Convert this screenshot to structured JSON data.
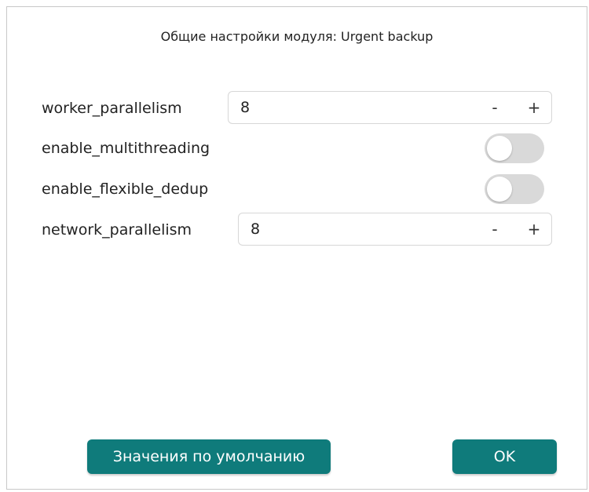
{
  "dialog": {
    "title": "Общие настройки модуля: Urgent backup"
  },
  "settings": [
    {
      "label": "worker_parallelism",
      "type": "stepper",
      "value": "8",
      "minus": "-",
      "plus": "+"
    },
    {
      "label": "enable_multithreading",
      "type": "toggle",
      "checked": false
    },
    {
      "label": "enable_flexible_dedup",
      "type": "toggle",
      "checked": false
    },
    {
      "label": "network_parallelism",
      "type": "stepper",
      "value": "8",
      "minus": "-",
      "plus": "+"
    }
  ],
  "buttons": {
    "defaults_label": "Значения по умолчанию",
    "ok_label": "OK"
  },
  "colors": {
    "accent": "#0f7b7b",
    "toggle_off": "#d9d9d9",
    "border": "#d7d7d7"
  }
}
